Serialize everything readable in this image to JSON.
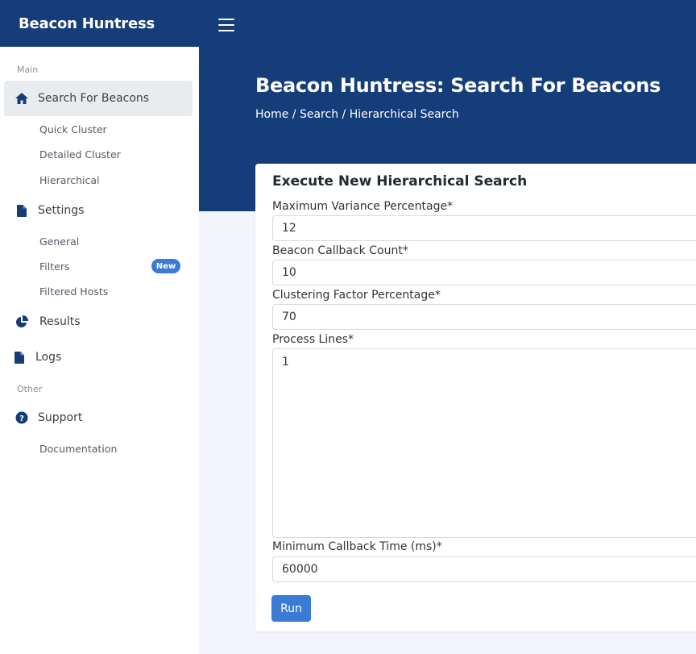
{
  "app": {
    "title": "Beacon Huntress"
  },
  "header": {
    "page_title": "Beacon Huntress: Search For Beacons",
    "breadcrumb": [
      "Home",
      "Search",
      "Hierarchical Search"
    ],
    "separator": " / "
  },
  "sidebar": {
    "main_label": "Main",
    "other_label": "Other",
    "search": {
      "label": "Search For Beacons",
      "icon": "home-icon"
    },
    "search_sub": [
      "Quick Cluster",
      "Detailed Cluster",
      "Hierarchical"
    ],
    "settings": {
      "label": "Settings",
      "icon": "file-icon"
    },
    "settings_sub": [
      "General",
      "Filters",
      "Filtered Hosts"
    ],
    "filters_badge": "New",
    "results": {
      "label": "Results",
      "icon": "pie-chart-icon"
    },
    "logs": {
      "label": "Logs",
      "icon": "file-icon"
    },
    "support": {
      "label": "Support",
      "icon": "question-circle-icon"
    },
    "support_sub": [
      "Documentation"
    ]
  },
  "form": {
    "title": "Execute New Hierarchical Search",
    "max_variance": {
      "label": "Maximum Variance Percentage*",
      "value": "12"
    },
    "callback_count": {
      "label": "Beacon Callback Count*",
      "value": "10"
    },
    "clustering_factor": {
      "label": "Clustering Factor Percentage*",
      "value": "70"
    },
    "process_lines": {
      "label": "Process Lines*",
      "value": "1"
    },
    "min_callback_time": {
      "label": "Minimum Callback Time (ms)*",
      "value": "60000"
    },
    "run_label": "Run"
  },
  "colors": {
    "primary": "#143d7a",
    "accent": "#3a7bd5"
  }
}
